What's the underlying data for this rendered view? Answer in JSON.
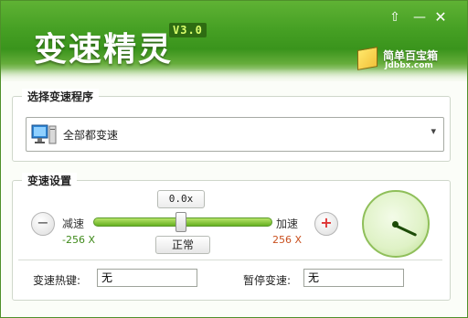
{
  "header": {
    "title": "变速精灵",
    "version": "V3.0",
    "logo_text": "简单百宝箱",
    "logo_sub": "Jdbbx.com",
    "controls": {
      "upload": "⇧",
      "minimize": "—",
      "close": "✕"
    }
  },
  "program_group": {
    "label": "选择变速程序",
    "selected": "全部都变速",
    "icon": "computer-icon"
  },
  "speed_group": {
    "label": "变速设置",
    "current_value": "0.0x",
    "slow_label": "减速",
    "fast_label": "加速",
    "min_value": "-256 X",
    "max_value": "256 X",
    "normal_button": "正常",
    "minus": "−",
    "plus": "+",
    "slider_fraction": 0.5,
    "hotkey_label": "变速热键:",
    "hotkey_value": "无",
    "pause_label": "暂停变速:",
    "pause_value": "无"
  },
  "colors": {
    "header_green": "#46a024",
    "slow_color": "#3f8a1a",
    "fast_color": "#c9501f"
  }
}
